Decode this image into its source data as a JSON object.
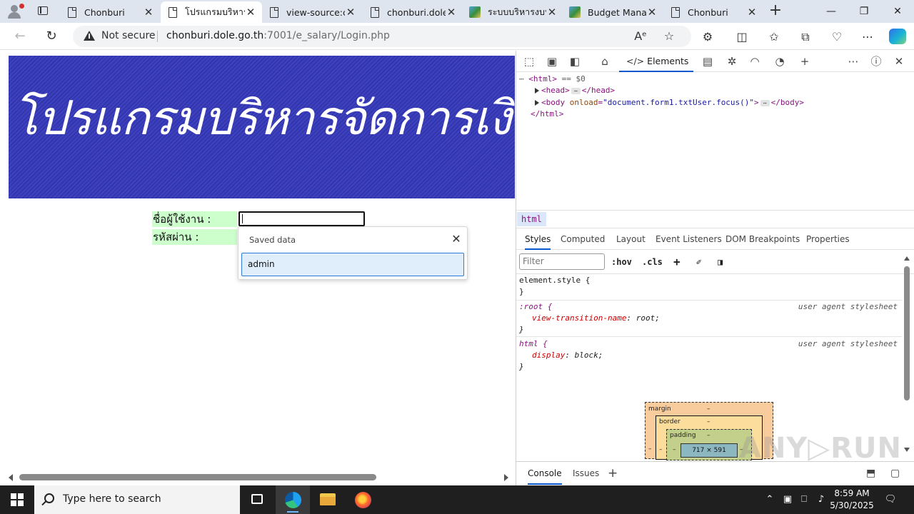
{
  "browser": {
    "tabs": [
      {
        "title": "Chonburi",
        "icon": "doc"
      },
      {
        "title": "โปรแกรมบริหาร",
        "icon": "doc",
        "active": true
      },
      {
        "title": "view-source:ch",
        "icon": "doc"
      },
      {
        "title": "chonburi.dole.",
        "icon": "doc"
      },
      {
        "title": "ระบบบริหารงบป",
        "icon": "img"
      },
      {
        "title": "Budget Manag",
        "icon": "img"
      },
      {
        "title": "Chonburi",
        "icon": "doc"
      }
    ],
    "tab_close_glyph": "✕",
    "new_tab_glyph": "+",
    "security_label": "Not secure",
    "url_host": "chonburi.dole.go.th",
    "url_path": ":7001/e_salary/Login.php"
  },
  "page": {
    "banner_text": "โปรแกรมบริหารจัดการเงินเดือน E-Salary สำนักงาน",
    "username_label": "ชื่อผู้ใช้งาน :",
    "password_label": "รหัสผ่าน :",
    "autofill": {
      "header": "Saved data",
      "items": [
        "admin"
      ]
    }
  },
  "devtools": {
    "active_tab": "Elements",
    "dom": {
      "html_open": "<html>",
      "selected_marker": "== $0",
      "head": "<head>",
      "head_close": "</head>",
      "body_open_tag": "<body",
      "body_attr_name": "onload",
      "body_attr_value": "\"document.form1.txtUser.focus()\"",
      "body_close": "</body>",
      "html_close": "</html>"
    },
    "breadcrumb": "html",
    "style_tabs": [
      "Styles",
      "Computed",
      "Layout",
      "Event Listeners",
      "DOM Breakpoints",
      "Properties"
    ],
    "filter_placeholder": "Filter",
    "hov": ":hov",
    "cls": ".cls",
    "rules": {
      "element_style": "element.style {",
      "close": "}",
      "root_selector": ":root {",
      "root_prop": "view-transition-name",
      "root_val": "root;",
      "html_selector": "html {",
      "html_prop": "display",
      "html_val": "block;",
      "source": "user agent stylesheet"
    },
    "box_model": {
      "margin": "margin",
      "border": "border",
      "padding": "padding",
      "dash": "–",
      "content": "717 × 591"
    },
    "drawer_tabs": [
      "Console",
      "Issues"
    ],
    "watermark": "ANY▷RUN"
  },
  "taskbar": {
    "search_placeholder": "Type here to search",
    "time": "8:59 AM",
    "date": "5/30/2025"
  }
}
